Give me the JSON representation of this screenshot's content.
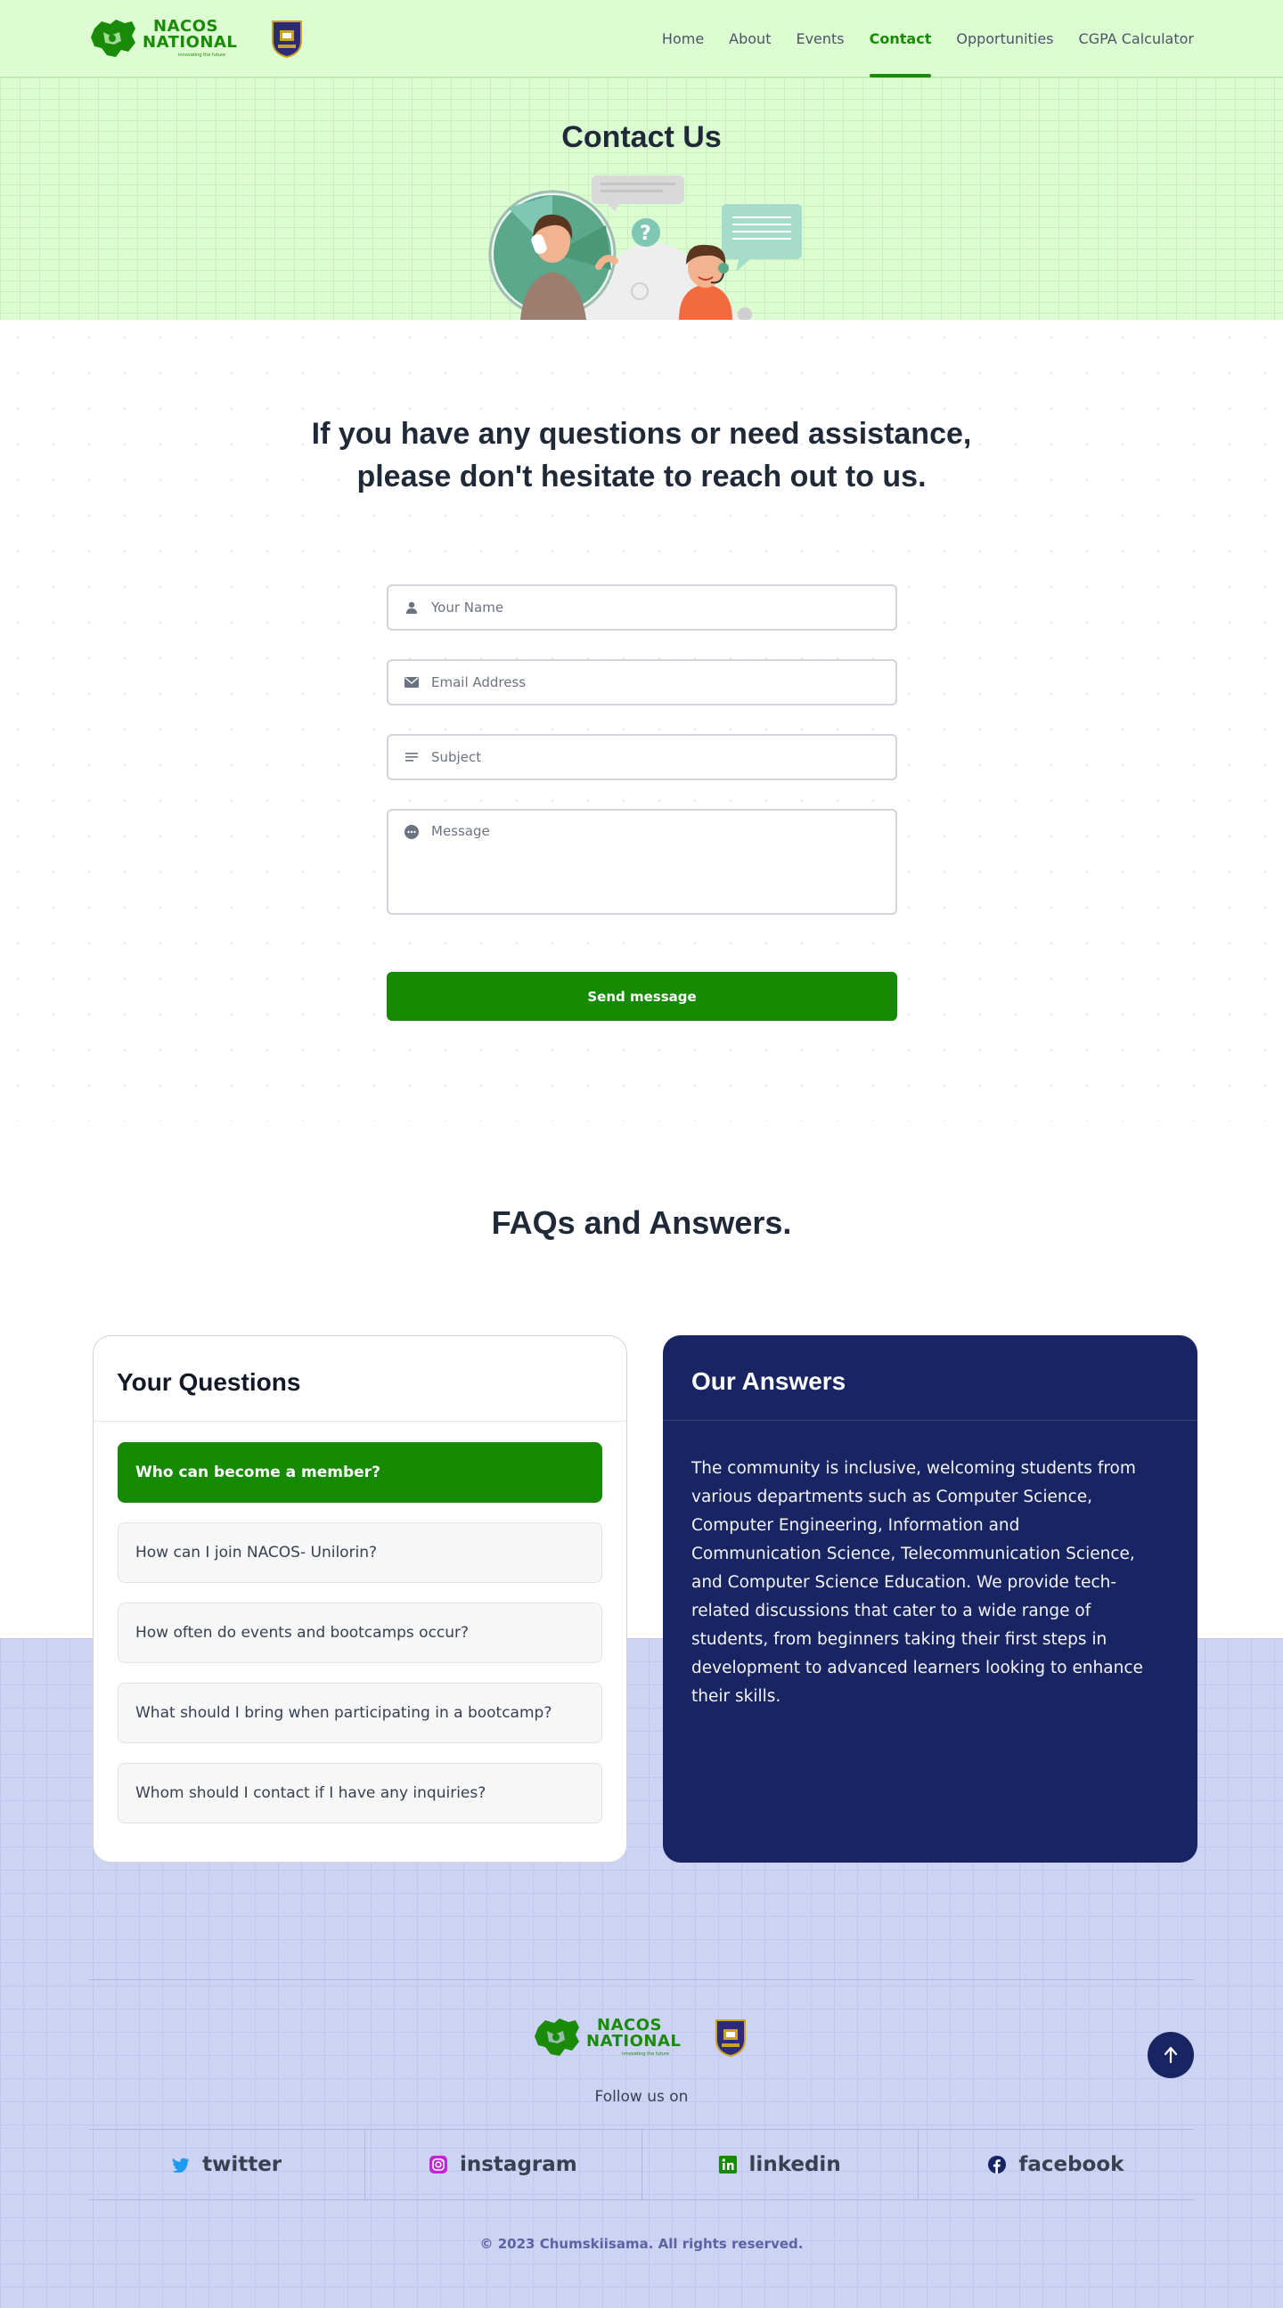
{
  "header": {
    "brand_line1": "NACOS",
    "brand_line2": "NATIONAL",
    "brand_tagline": "innovating the future",
    "nav": [
      "Home",
      "About",
      "Events",
      "Contact",
      "Opportunities",
      "CGPA Calculator"
    ],
    "active_nav": "Contact"
  },
  "hero": {
    "title": "Contact Us"
  },
  "contact": {
    "lead_line1": "If you have any questions or need assistance,",
    "lead_line2": "please don't hesitate to reach out to us.",
    "name_placeholder": "Your Name",
    "email_placeholder": "Email Address",
    "subject_placeholder": "Subject",
    "message_placeholder": "Message",
    "send_label": "Send message"
  },
  "faq": {
    "title": "FAQs and Answers.",
    "questions_heading": "Your Questions",
    "answers_heading": "Our Answers",
    "questions": [
      "Who can become a member?",
      "How can I join NACOS- Unilorin?",
      "How often do events and bootcamps occur?",
      "What should I bring when participating in a bootcamp?",
      "Whom should I contact if I have any inquiries?"
    ],
    "active_question": 0,
    "answer": "The community is inclusive, welcoming students from various departments such as Computer Science, Computer Engineering, Information and Communication Science, Telecommunication Science, and Computer Science Education. We provide tech-related discussions that cater to a wide range of students, from beginners taking their first steps in development to advanced learners looking to enhance their skills."
  },
  "footer": {
    "follow_label": "Follow us on",
    "socials": [
      {
        "label": "twitter",
        "icon": "twitter-icon",
        "color": "#1d9bf0"
      },
      {
        "label": "instagram",
        "icon": "instagram-icon",
        "color": "#c026d3"
      },
      {
        "label": "linkedin",
        "icon": "linkedin-icon",
        "color": "#168a03"
      },
      {
        "label": "facebook",
        "icon": "facebook-icon",
        "color": "#192463"
      }
    ],
    "copyright": "© 2023 Chumskiisama. All rights reserved."
  },
  "colors": {
    "brand_green": "#168a03",
    "navy": "#192463",
    "hero_bg": "#dcfcd2",
    "faq_bg": "#cdd3f3"
  }
}
